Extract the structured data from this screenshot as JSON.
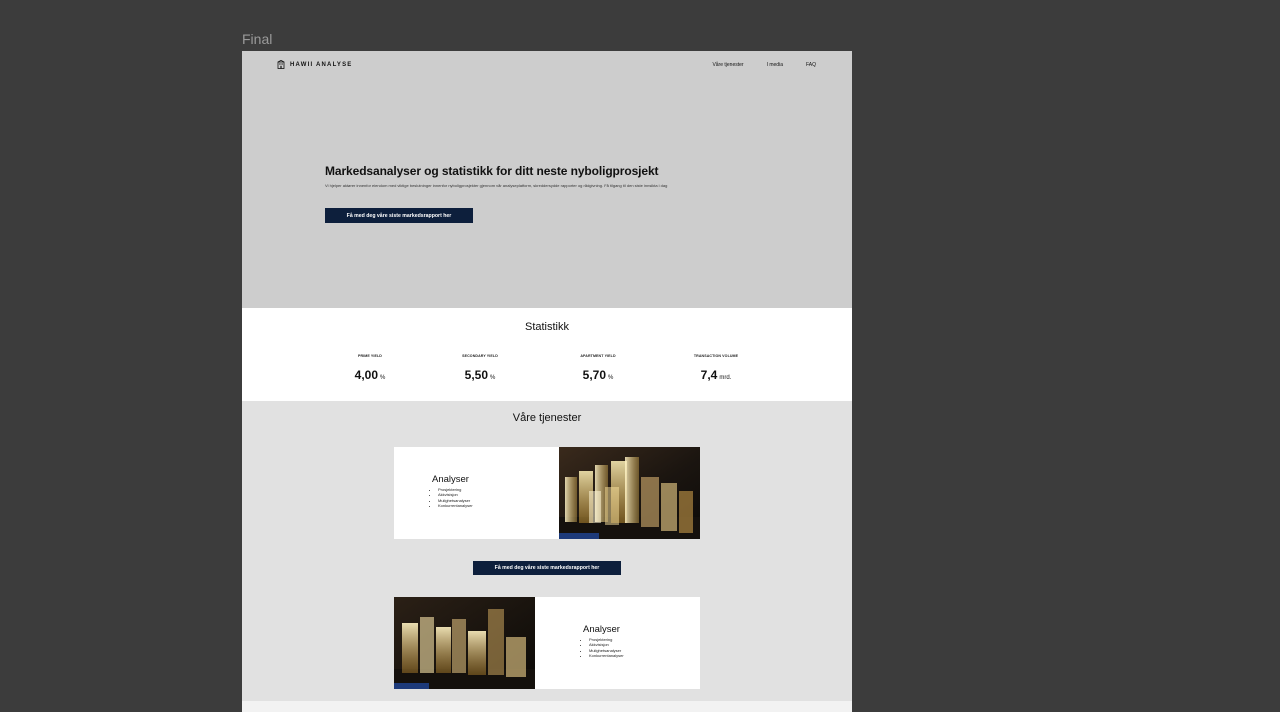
{
  "canvas": {
    "frame_label": "Final"
  },
  "header": {
    "logo_text": "HAWII ANALYSE",
    "nav": [
      "Våre tjenester",
      "I media",
      "FAQ"
    ]
  },
  "hero": {
    "title": "Markedsanalyser og statistikk for ditt neste nyboligprosjekt",
    "subtitle": "Vi hjelper aktører innenfor eiendom med viktige beslutninger innenfor nyboligprosjekter gjennom vår analyseplatform, skreddersydde rapporter og rådgivning. Få tilgang til den siste innsikta i dag",
    "cta_label": "Få med deg våre siste markedsrapport her"
  },
  "stats": {
    "title": "Statistikk",
    "items": [
      {
        "label": "PRIME YIELD",
        "value": "4,00",
        "unit": "%"
      },
      {
        "label": "SECONDARY YIELD",
        "value": "5,50",
        "unit": "%"
      },
      {
        "label": "APARTMENT YIELD",
        "value": "5,70",
        "unit": "%"
      },
      {
        "label": "TRANSACTION VOLUME",
        "value": "7,4",
        "unit": "mrd."
      }
    ]
  },
  "services": {
    "title": "Våre tjenester",
    "cards": [
      {
        "heading": "Analyser",
        "items": [
          "Prosjektering",
          "Akkvisisjon",
          "Mulighetsanalyser",
          "Konkurrentanalyser"
        ]
      },
      {
        "heading": "Analyser",
        "items": [
          "Prosjektering",
          "Akkvisisjon",
          "Mulighetsanalyser",
          "Konkurrentanalyser"
        ]
      }
    ],
    "cta_label": "Få med deg våre siste markedsrapport her"
  },
  "colors": {
    "canvas_bg": "#3c3c3c",
    "hero_bg": "#cdcdcd",
    "services_bg": "#e1e1e1",
    "button_bg": "#0d1f3c"
  }
}
